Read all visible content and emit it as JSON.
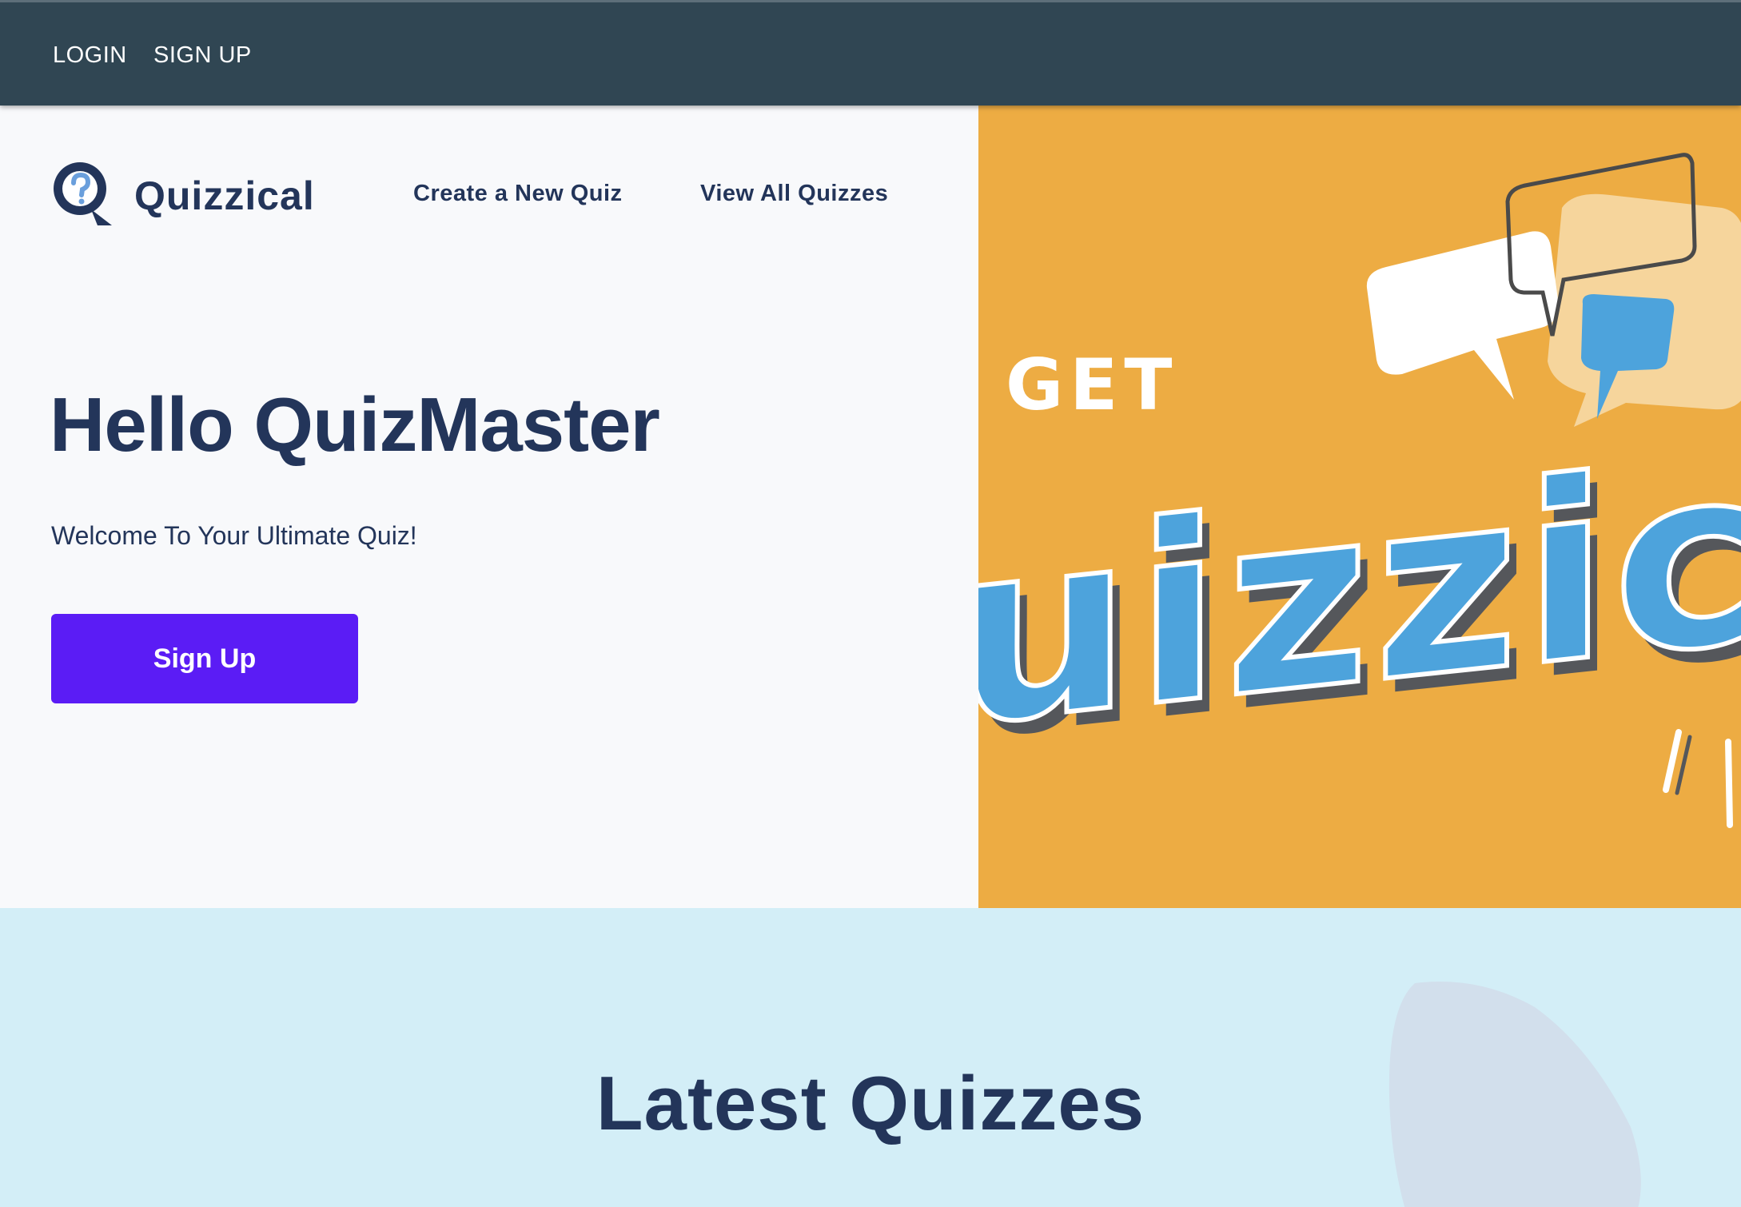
{
  "topbar": {
    "login_label": "LOGIN",
    "signup_label": "SIGN UP"
  },
  "header": {
    "brand": "Quizzical",
    "nav": {
      "create": "Create a New Quiz",
      "view_all": "View All Quizzes"
    }
  },
  "hero": {
    "title": "Hello QuizMaster",
    "subtitle": "Welcome To Your Ultimate Quiz!",
    "cta_label": "Sign Up",
    "banner": {
      "top_word": "GET",
      "big_word": "uizzic"
    }
  },
  "latest": {
    "title": "Latest Quizzes"
  },
  "colors": {
    "topbar": "#304653",
    "text_dark": "#23355a",
    "cta": "#5b1cf5",
    "banner_bg": "#edac43",
    "letter_blue": "#4da3dc",
    "letter_shadow": "#55575b",
    "latest_bg": "#d3eef7"
  },
  "icons": {
    "logo": "question-speech-bubble-icon"
  }
}
